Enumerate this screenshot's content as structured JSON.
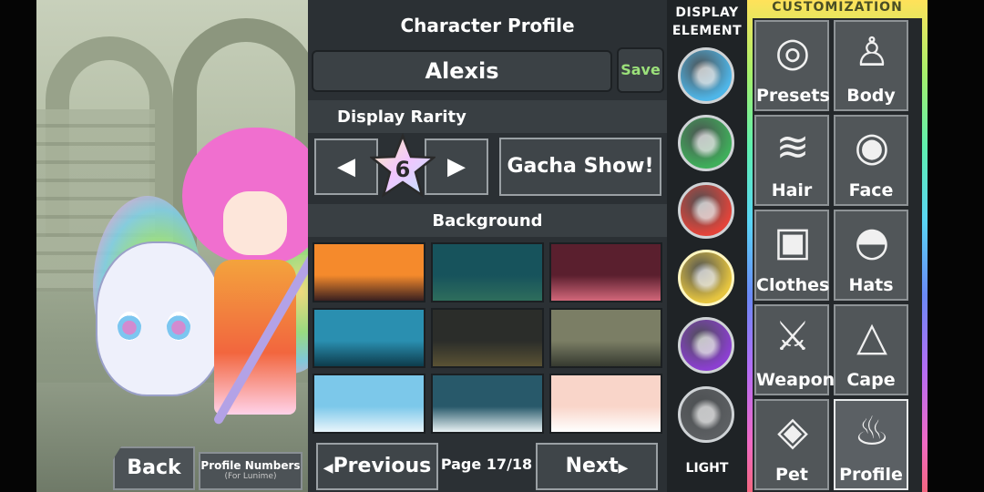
{
  "scene": {
    "back_label": "Back",
    "profile_numbers_label": "Profile Numbers",
    "profile_numbers_sub": "(For Lunime)"
  },
  "profile": {
    "title": "Character Profile",
    "name": "Alexis",
    "save_label": "Save",
    "rarity_title": "Display Rarity",
    "rarity_value": "6",
    "gacha_show_label": "Gacha Show!",
    "background_title": "Background",
    "backgrounds": [
      {
        "name": "halloween-graveyard-orange",
        "colors": [
          "#f58a2c",
          "#3a2020"
        ]
      },
      {
        "name": "night-graveyard-teal",
        "colors": [
          "#17535c",
          "#2e6d5c"
        ]
      },
      {
        "name": "haunted-house",
        "colors": [
          "#5a1f2e",
          "#d2677a"
        ]
      },
      {
        "name": "bats-teal-night",
        "colors": [
          "#2a8fb0",
          "#0e3c4c"
        ]
      },
      {
        "name": "dark-forest-eyes",
        "colors": [
          "#2b2d2a",
          "#5a5234"
        ]
      },
      {
        "name": "misty-graveyard",
        "colors": [
          "#7b7e65",
          "#363a30"
        ]
      },
      {
        "name": "igloo-snow",
        "colors": [
          "#7cc8ea",
          "#e9f5fb"
        ]
      },
      {
        "name": "christmas-tree",
        "colors": [
          "#28596a",
          "#e8f1f3"
        ]
      },
      {
        "name": "snowy-town",
        "colors": [
          "#f9d5c9",
          "#ffffff"
        ]
      }
    ],
    "prev_label": "Previous",
    "next_label": "Next",
    "page_label": "Page 17/18"
  },
  "elements": {
    "title_line1": "DISPLAY",
    "title_line2": "ELEMENT",
    "items": [
      {
        "name": "water",
        "color": "#4fb6e8"
      },
      {
        "name": "nature",
        "color": "#3fae5a"
      },
      {
        "name": "fire",
        "color": "#e2443a"
      },
      {
        "name": "light",
        "color": "#e6c540"
      },
      {
        "name": "dark",
        "color": "#8b3fd0"
      },
      {
        "name": "neutral",
        "color": "#5c5f62"
      }
    ],
    "selected_label": "LIGHT"
  },
  "customization": {
    "title": "CUSTOMIZATION",
    "items": [
      {
        "label": "Presets",
        "icon": "swirl-icon"
      },
      {
        "label": "Body",
        "icon": "body-icon"
      },
      {
        "label": "Hair",
        "icon": "hair-icon"
      },
      {
        "label": "Face",
        "icon": "eye-icon"
      },
      {
        "label": "Clothes",
        "icon": "shirt-icon"
      },
      {
        "label": "Hats",
        "icon": "cap-icon"
      },
      {
        "label": "Weapon",
        "icon": "dagger-icon"
      },
      {
        "label": "Cape",
        "icon": "cape-icon"
      },
      {
        "label": "Pet",
        "icon": "cat-icon"
      },
      {
        "label": "Profile",
        "icon": "flame-icon"
      }
    ]
  }
}
